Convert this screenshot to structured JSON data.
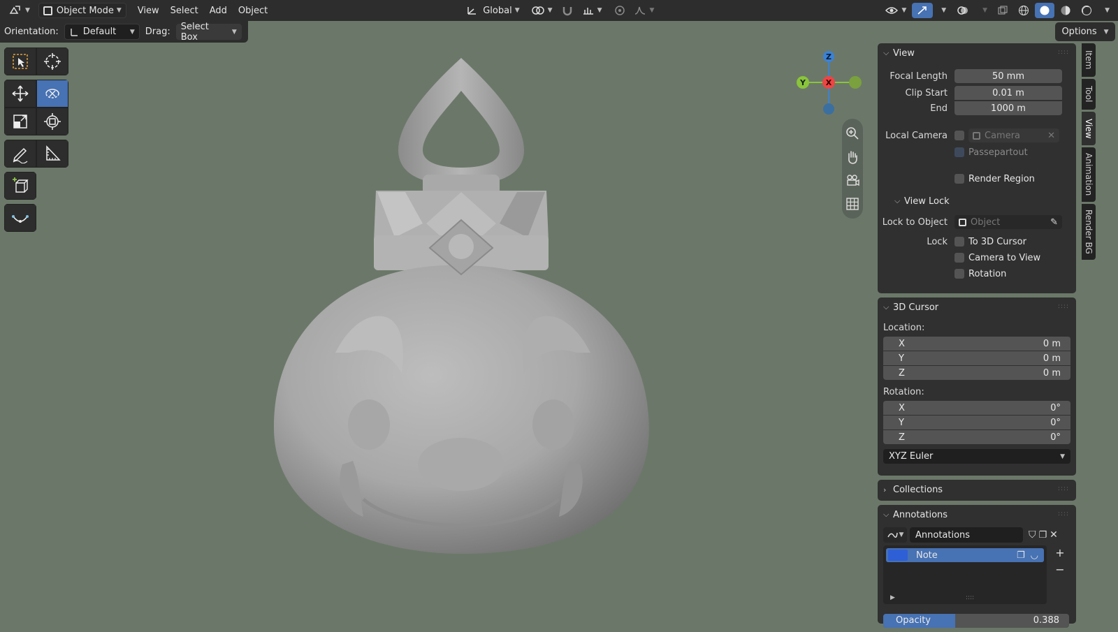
{
  "header": {
    "mode": "Object Mode",
    "menus": [
      "View",
      "Select",
      "Add",
      "Object"
    ],
    "transform_orientation": "Global"
  },
  "tool_header": {
    "orientation_label": "Orientation:",
    "orientation_value": "Default",
    "drag_label": "Drag:",
    "drag_value": "Select Box",
    "options_label": "Options"
  },
  "gizmo": {
    "z": "Z",
    "y": "Y",
    "x": "X"
  },
  "sidebar_tabs": [
    "Item",
    "Tool",
    "View",
    "Animation",
    "Render BG"
  ],
  "view_panel": {
    "title": "View",
    "focal_length_label": "Focal Length",
    "focal_length": "50 mm",
    "clip_start_label": "Clip Start",
    "clip_start": "0.01 m",
    "end_label": "End",
    "end": "1000 m",
    "local_camera_label": "Local Camera",
    "camera_placeholder": "Camera",
    "passepartout_label": "Passepartout",
    "render_region_label": "Render Region",
    "view_lock_title": "View Lock",
    "lock_to_object_label": "Lock to Object",
    "object_placeholder": "Object",
    "lock_label": "Lock",
    "to_3d_cursor_label": "To 3D Cursor",
    "camera_to_view_label": "Camera to View",
    "rotation_label": "Rotation"
  },
  "cursor_panel": {
    "title": "3D Cursor",
    "location_label": "Location:",
    "location": [
      {
        "axis": "X",
        "value": "0 m"
      },
      {
        "axis": "Y",
        "value": "0 m"
      },
      {
        "axis": "Z",
        "value": "0 m"
      }
    ],
    "rotation_label": "Rotation:",
    "rotation": [
      {
        "axis": "X",
        "value": "0°"
      },
      {
        "axis": "Y",
        "value": "0°"
      },
      {
        "axis": "Z",
        "value": "0°"
      }
    ],
    "rotation_mode": "XYZ Euler"
  },
  "collections_panel": {
    "title": "Collections"
  },
  "annotations_panel": {
    "title": "Annotations",
    "datablock": "Annotations",
    "layer_name": "Note",
    "opacity_label": "Opacity",
    "opacity_value": "0.388",
    "opacity_fraction": 0.388
  },
  "colors": {
    "viewport_bg": "#6b7869",
    "accent": "#4772b3",
    "gizmo_x": "#ee4444",
    "gizmo_y": "#8ac43a",
    "gizmo_z": "#3b82d6"
  }
}
